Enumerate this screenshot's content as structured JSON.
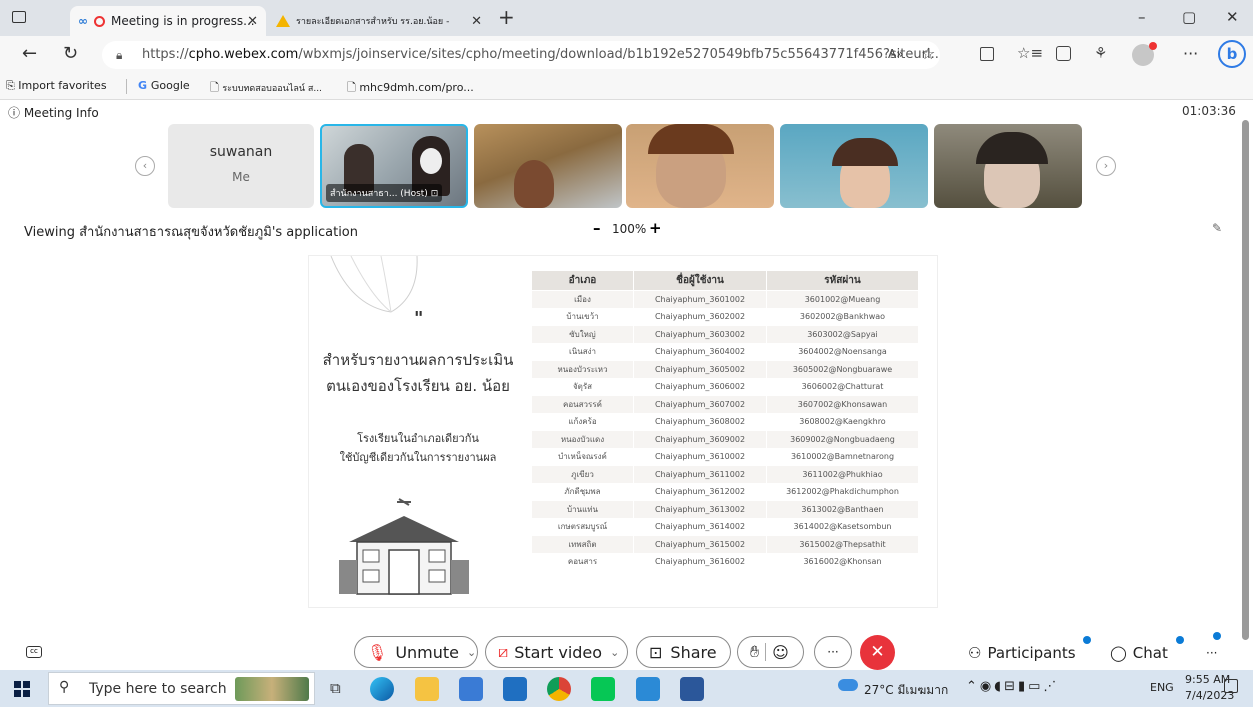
{
  "browser": {
    "tabs": [
      {
        "label": "Meeting is in progress..."
      },
      {
        "label": "รายละเอียดเอกสารสำหรับ รร.อย.น้อย -"
      }
    ],
    "new_tab": "+",
    "url_prefix": "https://",
    "url_domain": "cpho.webex.com",
    "url_path": "/wbxmjs/joinservice/sites/cpho/meeting/download/b1b192e5270549bfb75c55643771f456?siteurl...",
    "favorites": [
      "Import favorites",
      "Google",
      "ระบบทดสอบออนไลน์ ส...",
      "mhc9dmh.com/pro..."
    ],
    "window": {
      "minimize": "–",
      "restore": "▢",
      "close": "✕"
    }
  },
  "meeting": {
    "info_label": "Meeting Info",
    "timer": "01:03:36",
    "self_tile": {
      "name": "suwanan",
      "sub": "Me"
    },
    "host_label": "สำนักงานสาธา... (Host)",
    "viewing_prefix": "Viewing ",
    "viewing_name": "สำนักงานสาธารณสุขจังหวัดชัยภูมิ",
    "viewing_suffix": "'s application",
    "zoom_minus": "–",
    "zoom_level": "100%",
    "zoom_plus": "+"
  },
  "document": {
    "quote_mark": "\"",
    "title_line1": "สำหรับรายงานผลการประเมิน",
    "title_line2": "ตนเองของโรงเรียน อย. น้อย",
    "note_line1": "โรงเรียนในอำเภอเดียวกัน",
    "note_line2": "ใช้บัญชีเดียวกันในการรายงานผล",
    "table_headers": [
      "อำเภอ",
      "ชื่อผู้ใช้งาน",
      "รหัสผ่าน"
    ],
    "table_rows": [
      [
        "เมือง",
        "Chaiyaphum_3601002",
        "3601002@Mueang"
      ],
      [
        "บ้านเขว้า",
        "Chaiyaphum_3602002",
        "3602002@Bankhwao"
      ],
      [
        "ซับใหญ่",
        "Chaiyaphum_3603002",
        "3603002@Sapyai"
      ],
      [
        "เนินสง่า",
        "Chaiyaphum_3604002",
        "3604002@Noensanga"
      ],
      [
        "หนองบัวระเหว",
        "Chaiyaphum_3605002",
        "3605002@Nongbuarawe"
      ],
      [
        "จัตุรัส",
        "Chaiyaphum_3606002",
        "3606002@Chatturat"
      ],
      [
        "คอนสวรรค์",
        "Chaiyaphum_3607002",
        "3607002@Khonsawan"
      ],
      [
        "แก้งคร้อ",
        "Chaiyaphum_3608002",
        "3608002@Kaengkhro"
      ],
      [
        "หนองบัวแดง",
        "Chaiyaphum_3609002",
        "3609002@Nongbuadaeng"
      ],
      [
        "บำเหน็จณรงค์",
        "Chaiyaphum_3610002",
        "3610002@Bamnetnarong"
      ],
      [
        "ภูเขียว",
        "Chaiyaphum_3611002",
        "3611002@Phukhiao"
      ],
      [
        "ภักดีชุมพล",
        "Chaiyaphum_3612002",
        "3612002@Phakdichumphon"
      ],
      [
        "บ้านแท่น",
        "Chaiyaphum_3613002",
        "3613002@Banthaen"
      ],
      [
        "เกษตรสมบูรณ์",
        "Chaiyaphum_3614002",
        "3614002@Kasetsombun"
      ],
      [
        "เทพสถิต",
        "Chaiyaphum_3615002",
        "3615002@Thepsathit"
      ],
      [
        "คอนสาร",
        "Chaiyaphum_3616002",
        "3616002@Khonsan"
      ]
    ]
  },
  "controls": {
    "unmute": "Unmute",
    "start_video": "Start video",
    "share": "Share",
    "more": "···",
    "participants": "Participants",
    "chat": "Chat"
  },
  "taskbar": {
    "search_placeholder": "Type here to search",
    "weather": "27°C มีเมฆมาก",
    "lang": "ENG",
    "time": "9:55 AM",
    "date": "7/4/2023"
  },
  "colors": {
    "accent": "#0b7bd6",
    "end_call": "#e8333b",
    "host_border": "#29b6e8"
  }
}
